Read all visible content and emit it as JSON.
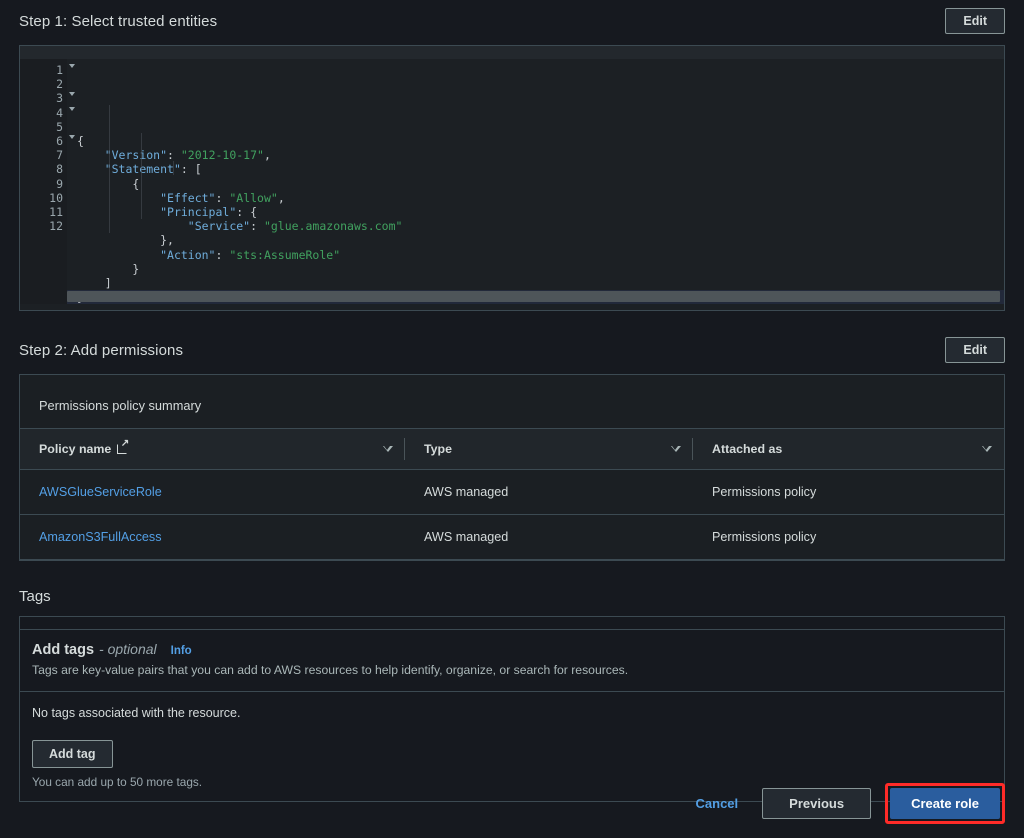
{
  "step1": {
    "title": "Step 1: Select trusted entities",
    "edit_label": "Edit",
    "editor": {
      "lines": [
        {
          "n": "1",
          "fold": true,
          "text": "{"
        },
        {
          "n": "2",
          "fold": false,
          "text": "    \"Version\": \"2012-10-17\","
        },
        {
          "n": "3",
          "fold": true,
          "text": "    \"Statement\": ["
        },
        {
          "n": "4",
          "fold": true,
          "text": "        {"
        },
        {
          "n": "5",
          "fold": false,
          "text": "            \"Effect\": \"Allow\","
        },
        {
          "n": "6",
          "fold": true,
          "text": "            \"Principal\": {"
        },
        {
          "n": "7",
          "fold": false,
          "text": "                \"Service\": \"glue.amazonaws.com\""
        },
        {
          "n": "8",
          "fold": false,
          "text": "            },"
        },
        {
          "n": "9",
          "fold": false,
          "text": "            \"Action\": \"sts:AssumeRole\""
        },
        {
          "n": "10",
          "fold": false,
          "text": "        }"
        },
        {
          "n": "11",
          "fold": false,
          "text": "    ]"
        },
        {
          "n": "12",
          "fold": false,
          "text": "}"
        }
      ],
      "policy_json": "{\n    \"Version\": \"2012-10-17\",\n    \"Statement\": [\n        {\n            \"Effect\": \"Allow\",\n            \"Principal\": {\n                \"Service\": \"glue.amazonaws.com\"\n            },\n            \"Action\": \"sts:AssumeRole\"\n        }\n    ]\n}",
      "active_line": 12
    }
  },
  "step2": {
    "title": "Step 2: Add permissions",
    "edit_label": "Edit",
    "summary_label": "Permissions policy summary",
    "columns": [
      "Policy name",
      "Type",
      "Attached as"
    ],
    "rows": [
      {
        "policy_name": "AWSGlueServiceRole",
        "type": "AWS managed",
        "attached_as": "Permissions policy"
      },
      {
        "policy_name": "AmazonS3FullAccess",
        "type": "AWS managed",
        "attached_as": "Permissions policy"
      }
    ]
  },
  "tags": {
    "title": "Tags",
    "heading": "Add tags",
    "optional_label": "- optional",
    "info_label": "Info",
    "description": "Tags are key-value pairs that you can add to AWS resources to help identify, organize, or search for resources.",
    "empty_message": "No tags associated with the resource.",
    "add_tag_label": "Add tag",
    "limit_hint": "You can add up to 50 more tags."
  },
  "footer": {
    "cancel_label": "Cancel",
    "previous_label": "Previous",
    "create_label": "Create role"
  },
  "colors": {
    "page_bg": "#16191f",
    "link_blue": "#539fe5",
    "primary_button": "#2a5d9e",
    "highlight_red": "#ff2b28",
    "border": "#3c4a52"
  }
}
